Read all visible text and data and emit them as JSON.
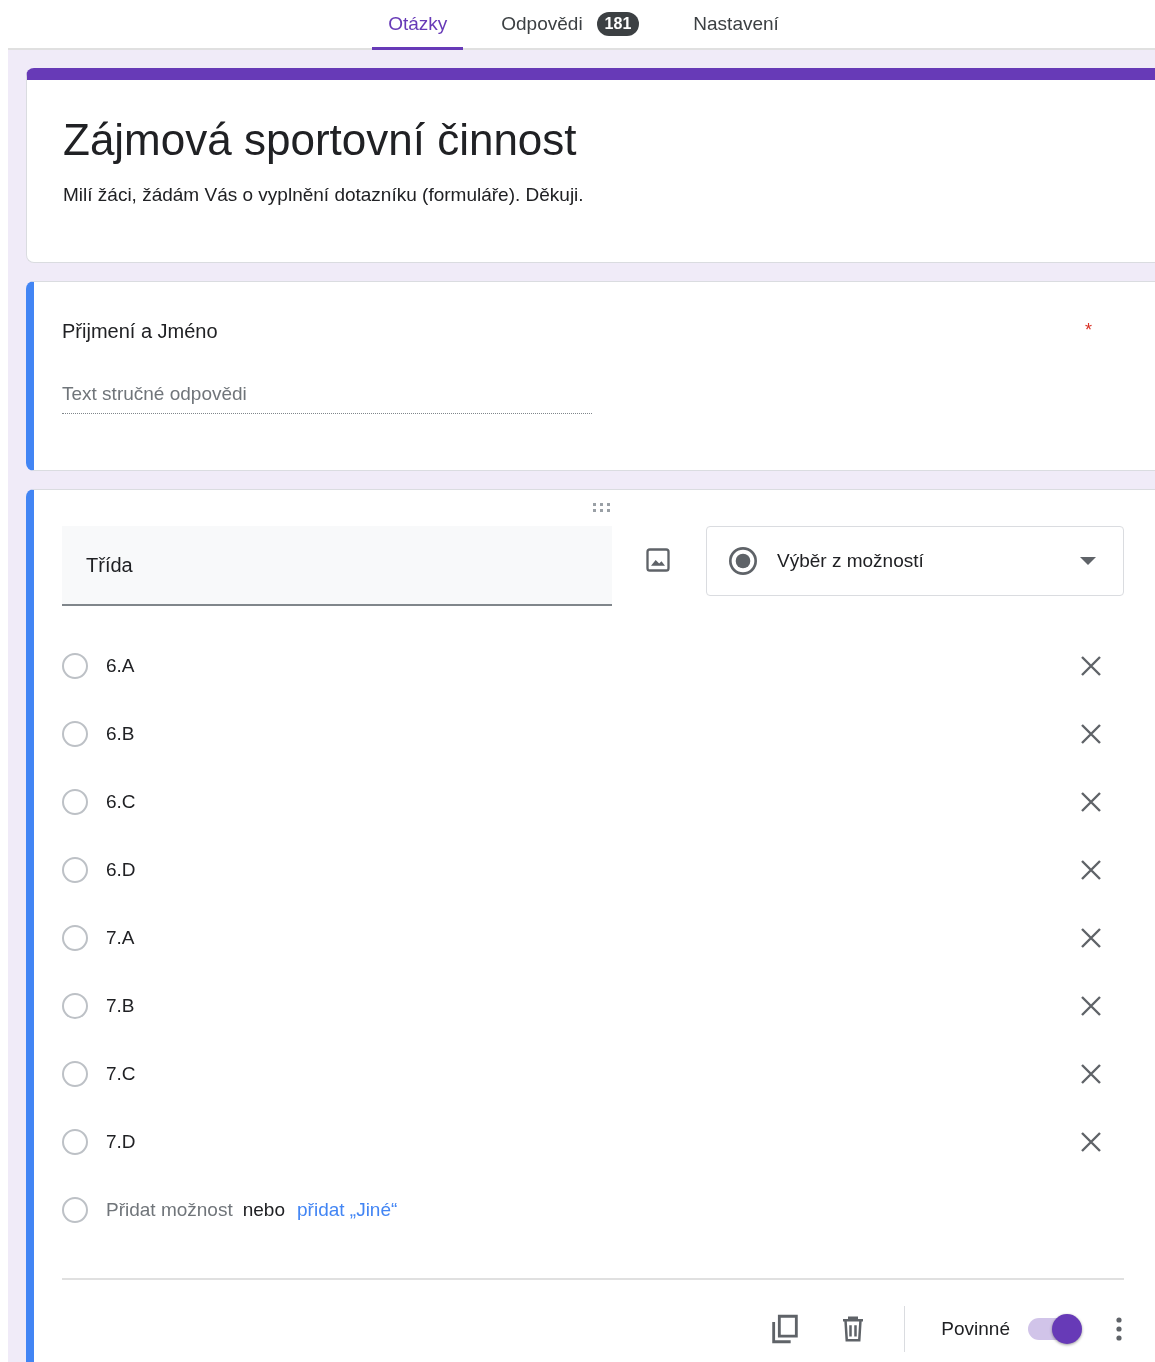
{
  "tabs": [
    {
      "label": "Otázky",
      "selected": true
    },
    {
      "label": "Odpovědi",
      "selected": false,
      "badge": "181"
    },
    {
      "label": "Nastavení",
      "selected": false
    }
  ],
  "header": {
    "title": "Zájmová sportovní činnost",
    "description": "Milí žáci, žádám Vás o vyplnění dotazníku (formuláře). Děkuji."
  },
  "questions": [
    {
      "kind": "short",
      "title": "Přijmení a Jméno",
      "required": true,
      "required_mark": "*",
      "placeholder": "Text stručné odpovědi"
    },
    {
      "kind": "choice",
      "title": "Třída",
      "type_label": "Výběr z možností",
      "options": [
        {
          "label": "6.A",
          "checked": false
        },
        {
          "label": "6.B",
          "checked": false
        },
        {
          "label": "6.C",
          "checked": false
        },
        {
          "label": "6.D",
          "checked": false
        },
        {
          "label": "7.A",
          "checked": false
        },
        {
          "label": "7.B",
          "checked": false
        },
        {
          "label": "7.C",
          "checked": false
        },
        {
          "label": "7.D",
          "checked": false
        }
      ],
      "add_option": {
        "label": "Přidat možnost",
        "joiner": "nebo",
        "link": "přidat „Jiné“",
        "checked": false
      },
      "required_label": "Povinné",
      "required": true
    }
  ]
}
